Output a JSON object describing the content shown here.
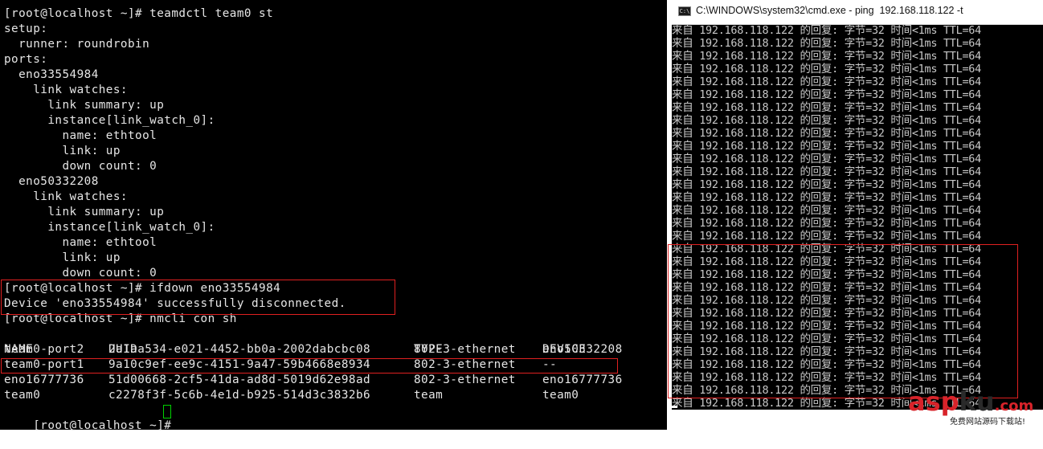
{
  "terminal": {
    "lines": [
      "[root@localhost ~]# teamdctl team0 st",
      "setup:",
      "  runner: roundrobin",
      "ports:",
      "  eno33554984",
      "    link watches:",
      "      link summary: up",
      "      instance[link_watch_0]:",
      "        name: ethtool",
      "        link: up",
      "        down count: 0",
      "  eno50332208",
      "    link watches:",
      "      link summary: up",
      "      instance[link_watch_0]:",
      "        name: ethtool",
      "        link: up",
      "        down count: 0",
      "[root@localhost ~]# ifdown eno33554984",
      "Device 'eno33554984' successfully disconnected.",
      "[root@localhost ~]# nmcli con sh"
    ],
    "table_headers": [
      "NAME",
      "UUID",
      "TYPE",
      "DEVICE"
    ],
    "table_rows": [
      [
        "team0-port2",
        "2a1aa534-e021-4452-bb0a-2002dabcbc08",
        "802-3-ethernet",
        "eno50332208"
      ],
      [
        "team0-port1",
        "9a10c9ef-ee9c-4151-9a47-59b4668e8934",
        "802-3-ethernet",
        "--"
      ],
      [
        "eno16777736",
        "51d00668-2cf5-41da-ad8d-5019d62e98ad",
        "802-3-ethernet",
        "eno16777736"
      ],
      [
        "team0",
        "c2278f3f-5c6b-4e1d-b925-514d3c3832b6",
        "team",
        "team0"
      ]
    ],
    "prompt": "[root@localhost ~]# "
  },
  "cmd_window": {
    "title": "C:\\WINDOWS\\system32\\cmd.exe - ping  192.168.118.122 -t",
    "icon_text": "C:\\",
    "reply_line": "来自 192.168.118.122 的回复: 字节=32 时间<1ms TTL=64",
    "reply_count": 30
  },
  "watermark": {
    "asp": "asp",
    "ku": "ku",
    "com": ".com",
    "subtitle": "免费网站源码下载站!"
  },
  "colors": {
    "terminal_bg": "#000000",
    "terminal_fg": "#e6e6e6",
    "highlight_box": "#e02020",
    "cursor": "#00d000",
    "watermark_red": "#d8232a",
    "watermark_dark": "#2a2a2a"
  }
}
